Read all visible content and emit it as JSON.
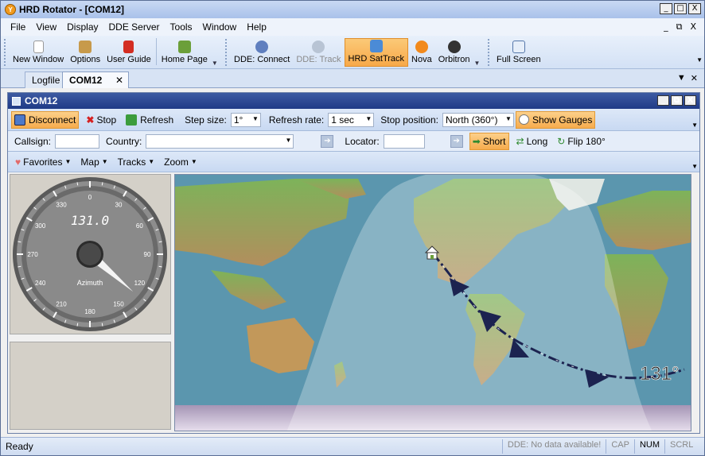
{
  "window": {
    "title": "HRD Rotator - [COM12]",
    "min": "_",
    "max": "□",
    "close": "X"
  },
  "menu": {
    "items": [
      "File",
      "View",
      "Display",
      "DDE Server",
      "Tools",
      "Window",
      "Help"
    ],
    "mdi_min": "_",
    "mdi_restore": "⧉",
    "mdi_close": "X"
  },
  "toolbar": {
    "new_window": "New Window",
    "options": "Options",
    "user_guide": "User Guide",
    "home_page": "Home Page",
    "dde_connect": "DDE: Connect",
    "dde_track": "DDE: Track",
    "hrd_sattrack": "HRD SatTrack",
    "nova": "Nova",
    "orbitron": "Orbitron",
    "full_screen": "Full Screen"
  },
  "tabs": {
    "logfile": "Logfile",
    "com12": "COM12",
    "close": "✕"
  },
  "child": {
    "title": "COM12"
  },
  "controls": {
    "disconnect": "Disconnect",
    "stop": "Stop",
    "refresh": "Refresh",
    "step_size_label": "Step size:",
    "step_size_value": "1°",
    "refresh_rate_label": "Refresh rate:",
    "refresh_rate_value": "1 sec",
    "stop_position_label": "Stop position:",
    "stop_position_value": "North (360°)",
    "show_gauges": "Show Gauges",
    "callsign_label": "Callsign:",
    "country_label": "Country:",
    "locator_label": "Locator:",
    "short": "Short",
    "long": "Long",
    "flip": "Flip 180°",
    "favorites": "Favorites",
    "map": "Map",
    "tracks": "Tracks",
    "zoom": "Zoom"
  },
  "gauge": {
    "readout": "131.0",
    "label": "Azimuth",
    "ticks": [
      "0",
      "30",
      "60",
      "90",
      "120",
      "150",
      "180",
      "210",
      "240",
      "270",
      "300",
      "330"
    ]
  },
  "map": {
    "bearing_label": "131°"
  },
  "status": {
    "ready": "Ready",
    "dde": "DDE: No data available!",
    "cap": "CAP",
    "num": "NUM",
    "scrl": "SCRL"
  },
  "colors": {
    "accent": "#f7a94a",
    "title": "#1f3a86",
    "track": "#1c2350",
    "ocean": "#5a95ad"
  }
}
